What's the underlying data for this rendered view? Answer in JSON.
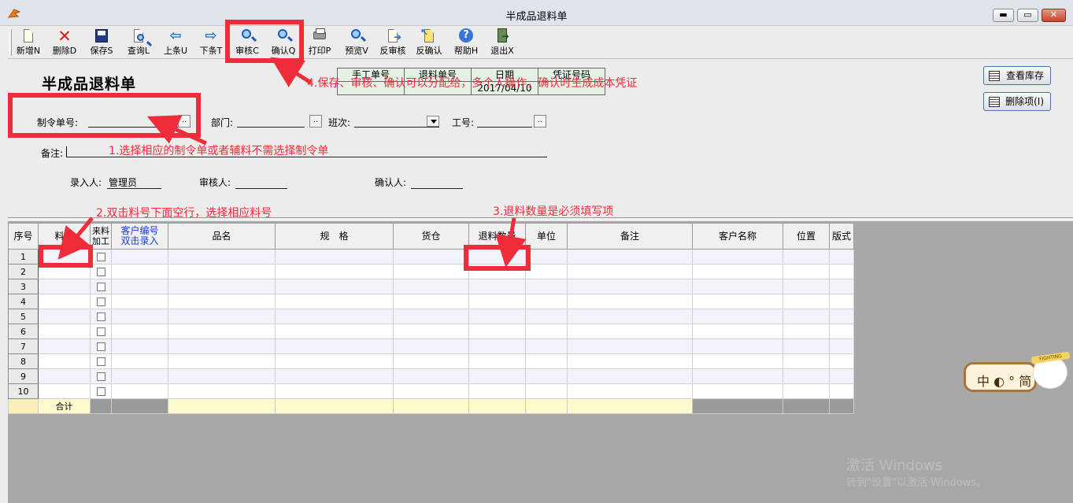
{
  "window": {
    "title": "半成品退料单",
    "min_glyph": "▬",
    "max_glyph": "▭",
    "close_glyph": "✕"
  },
  "toolbar": [
    {
      "label": "新增N",
      "icon": "new-document-icon"
    },
    {
      "label": "删除D",
      "icon": "delete-x-icon"
    },
    {
      "label": "保存S",
      "icon": "save-disk-icon"
    },
    {
      "label": "查询L",
      "icon": "query-document-icon"
    },
    {
      "label": "上条U",
      "icon": "arrow-left-icon"
    },
    {
      "label": "下条T",
      "icon": "arrow-right-icon"
    },
    {
      "label": "审核C",
      "icon": "magnifier-icon"
    },
    {
      "label": "确认Q",
      "icon": "magnifier-icon"
    },
    {
      "label": "打印P",
      "icon": "printer-icon"
    },
    {
      "label": "预览V",
      "icon": "magnifier-icon"
    },
    {
      "label": "反审核",
      "icon": "unapprove-icon"
    },
    {
      "label": "反确认",
      "icon": "unconfirm-icon"
    },
    {
      "label": "帮助H",
      "icon": "help-icon"
    },
    {
      "label": "退出X",
      "icon": "exit-door-icon"
    }
  ],
  "form": {
    "title": "半成品退料单",
    "info_headers": [
      "手工单号",
      "退料单号",
      "日期",
      "凭证号码"
    ],
    "info_values": [
      "",
      "",
      "2017/04/10",
      ""
    ],
    "fields": {
      "order_no_label": "制令单号:",
      "order_no_value": "",
      "dept_label": "部门:",
      "dept_value": "",
      "shift_label": "班次:",
      "shift_value": "",
      "worker_label": "工号:",
      "worker_value": "",
      "remark_label": "备注:",
      "remark_value": "",
      "entered_by_label": "录入人:",
      "entered_by_value": "管理员",
      "reviewer_label": "审核人:",
      "reviewer_value": "",
      "confirmer_label": "确认人:",
      "confirmer_value": ""
    },
    "ellipsis": "..",
    "side_buttons": {
      "stock": "查看库存",
      "delete_item": "删除项(I)"
    }
  },
  "annotations": {
    "a1": "1.选择相应的制令单或者辅料不需选择制令单",
    "a2": "2.双击料号下面空行，选择相应料号",
    "a3": "3.退料数量是必须填写项",
    "a4": "4.保存、审核、确认可以分配给，多个人操作，确认时生成成本凭证"
  },
  "grid": {
    "headers": {
      "seq": "序号",
      "part": "料号",
      "outsource": "来料加工",
      "cust_code_1": "客户编号",
      "cust_code_2": "双击录入",
      "name": "品名",
      "spec": "规　格",
      "warehouse": "货仓",
      "qty": "退料数量",
      "unit": "单位",
      "remark": "备注",
      "customer": "客户名称",
      "location": "位置",
      "version": "版式"
    },
    "rows": [
      "1",
      "2",
      "3",
      "4",
      "5",
      "6",
      "7",
      "8",
      "9",
      "10"
    ],
    "total_label": "合计"
  },
  "ime": {
    "text": "中 ◐ ° 简",
    "mascot_text": "FIGHTING"
  },
  "watermark": {
    "line1": "激活 Windows",
    "line2": "转到\"设置\"以激活 Windows。"
  }
}
